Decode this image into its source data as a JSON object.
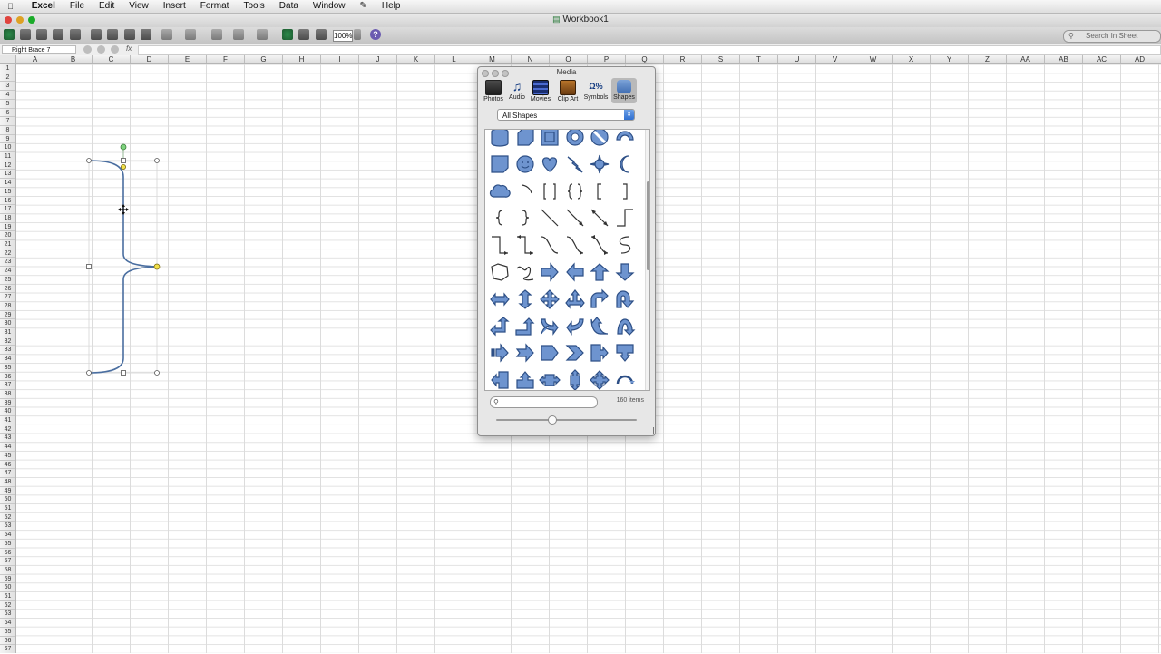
{
  "menubar": {
    "app": "Excel",
    "items": [
      "File",
      "Edit",
      "View",
      "Insert",
      "Format",
      "Tools",
      "Data",
      "Window",
      "Help"
    ]
  },
  "window": {
    "title": "Workbook1"
  },
  "toolbar": {
    "zoom": "100%",
    "help": "?",
    "search_placeholder": "Search In Sheet"
  },
  "formula_bar": {
    "name_box": "Right Brace 7",
    "fx_label": "fx"
  },
  "columns": [
    "A",
    "B",
    "C",
    "D",
    "E",
    "F",
    "G",
    "H",
    "I",
    "J",
    "K",
    "L",
    "M",
    "N",
    "O",
    "P",
    "Q",
    "R",
    "S",
    "T",
    "U",
    "V",
    "W",
    "X",
    "Y",
    "Z",
    "AA",
    "AB",
    "AC",
    "AD"
  ],
  "selected_shape": {
    "name": "Right Brace 7"
  },
  "media_palette": {
    "title": "Media",
    "tabs": [
      {
        "label": "Photos"
      },
      {
        "label": "Audio"
      },
      {
        "label": "Movies"
      },
      {
        "label": "Clip Art"
      },
      {
        "label": "Symbols"
      },
      {
        "label": "Shapes"
      }
    ],
    "active_tab": "Shapes",
    "category": "All Shapes",
    "search_value": "",
    "item_count": "160 items",
    "shapes": [
      "can",
      "cube",
      "bevel",
      "donut",
      "no-symbol",
      "block-arc",
      "folded-corner",
      "smiley-face",
      "heart",
      "lightning-bolt",
      "sun",
      "moon",
      "cloud",
      "arc",
      "double-bracket",
      "double-brace",
      "left-bracket",
      "right-bracket",
      "left-brace",
      "right-brace",
      "straight-connector",
      "straight-arrow-connector",
      "double-arrow-connector",
      "elbow-connector",
      "elbow-arrow-connector",
      "elbow-double-arrow-connector",
      "curved-connector",
      "curved-arrow-connector",
      "curved-double-arrow-connector",
      "s-curve",
      "freeform",
      "scribble",
      "right-arrow",
      "left-arrow",
      "up-arrow",
      "down-arrow",
      "left-right-arrow",
      "up-down-arrow",
      "quad-arrow",
      "left-right-up-arrow",
      "bent-arrow",
      "u-turn-arrow",
      "left-up-arrow",
      "bent-up-arrow",
      "curved-right-arrow",
      "curved-left-arrow",
      "curved-up-arrow",
      "curved-down-arrow",
      "striped-right-arrow",
      "notched-right-arrow",
      "pentagon",
      "chevron",
      "right-arrow-callout",
      "down-arrow-callout",
      "left-arrow-callout",
      "up-arrow-callout",
      "left-right-arrow-callout",
      "up-down-arrow-callout",
      "quad-arrow-callout",
      "circular-arrow"
    ]
  }
}
